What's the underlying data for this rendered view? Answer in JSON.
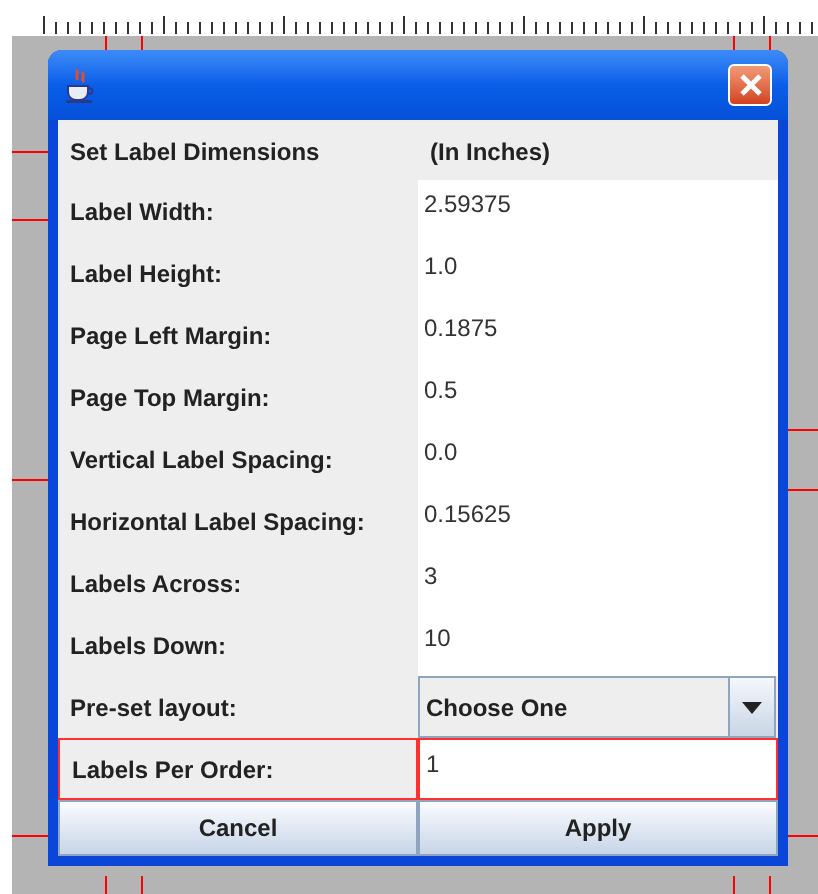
{
  "dialog": {
    "header": {
      "label": "Set Label Dimensions",
      "unit": "(In Inches)"
    },
    "fields": [
      {
        "kind": "text",
        "label": "Label Width:",
        "value": "2.59375"
      },
      {
        "kind": "text",
        "label": "Label Height:",
        "value": "1.0"
      },
      {
        "kind": "text",
        "label": "Page Left Margin:",
        "value": "0.1875"
      },
      {
        "kind": "text",
        "label": "Page Top Margin:",
        "value": "0.5"
      },
      {
        "kind": "text",
        "label": "Vertical Label Spacing:",
        "value": "0.0"
      },
      {
        "kind": "text",
        "label": "Horizontal Label Spacing:",
        "value": "0.15625"
      },
      {
        "kind": "text",
        "label": "Labels Across:",
        "value": "3"
      },
      {
        "kind": "text",
        "label": "Labels Down:",
        "value": "10"
      },
      {
        "kind": "select",
        "label": "Pre-set layout:",
        "value": "Choose One"
      },
      {
        "kind": "text",
        "label": "Labels Per Order:",
        "value": "1",
        "invalid": true
      }
    ],
    "buttons": [
      "Cancel",
      "Apply"
    ]
  }
}
